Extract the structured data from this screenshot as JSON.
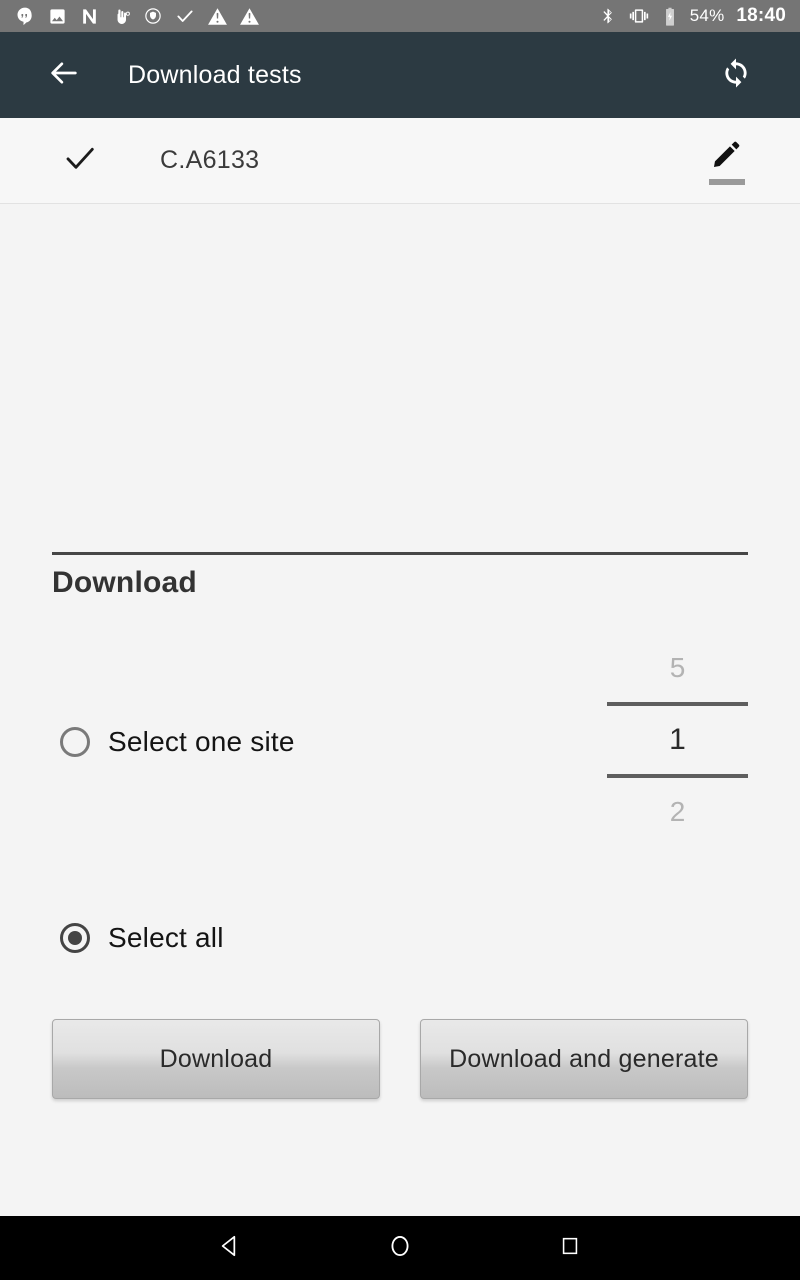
{
  "status_bar": {
    "background": "#757575",
    "left_icons": [
      {
        "name": "hangouts-icon"
      },
      {
        "name": "photos-icon"
      },
      {
        "name": "nova-launcher-icon"
      },
      {
        "name": "touch-gesture-icon"
      },
      {
        "name": "shield-icon"
      },
      {
        "name": "checkmark-icon"
      },
      {
        "name": "warning-triangle-icon"
      },
      {
        "name": "warning-triangle-icon-2"
      }
    ],
    "bluetooth_icon": "bluetooth-icon",
    "vibrate_icon": "vibrate-icon",
    "battery_icon": "battery-charging-icon",
    "battery_percent": "54%",
    "time": "18:40"
  },
  "app_bar": {
    "background": "#2c3a42",
    "back_icon": "back-arrow-icon",
    "title": "Download tests",
    "action_icon": "sync-refresh-icon"
  },
  "sub_header": {
    "check_icon": "checkmark-icon",
    "label": "C.A6133",
    "edit_icon": "edit-pencil-icon"
  },
  "download_section": {
    "title": "Download",
    "number_picker": {
      "previous_value": "5",
      "current_value": "1",
      "next_value": "2"
    },
    "options": [
      {
        "label": "Select one site",
        "checked": false
      },
      {
        "label": "Select all",
        "checked": true
      }
    ],
    "buttons": [
      {
        "label": "Download"
      },
      {
        "label": "Download and generate"
      }
    ]
  },
  "nav_bar": {
    "background": "#000000",
    "back_icon": "nav-back-triangle-icon",
    "home_icon": "nav-home-circle-icon",
    "recents_icon": "nav-recents-square-icon"
  }
}
